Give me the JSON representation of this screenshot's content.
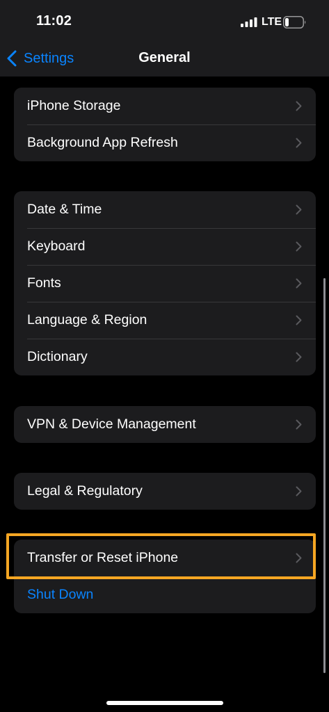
{
  "status_bar": {
    "time": "11:02",
    "network": "LTE"
  },
  "nav": {
    "back_label": "Settings",
    "title": "General"
  },
  "groups": [
    {
      "items": [
        {
          "label": "iPhone Storage"
        },
        {
          "label": "Background App Refresh"
        }
      ]
    },
    {
      "items": [
        {
          "label": "Date & Time"
        },
        {
          "label": "Keyboard"
        },
        {
          "label": "Fonts"
        },
        {
          "label": "Language & Region"
        },
        {
          "label": "Dictionary"
        }
      ]
    },
    {
      "items": [
        {
          "label": "VPN & Device Management"
        }
      ]
    },
    {
      "items": [
        {
          "label": "Legal & Regulatory"
        }
      ]
    },
    {
      "items": [
        {
          "label": "Transfer or Reset iPhone"
        },
        {
          "label": "Shut Down"
        }
      ]
    }
  ],
  "colors": {
    "background": "#000000",
    "cell": "#1c1c1e",
    "accent_blue": "#0a84ff",
    "highlight": "#f5a623"
  },
  "icons": {
    "back": "chevron-left-icon",
    "row": "chevron-right-icon",
    "signal": "cellular-signal-icon",
    "battery": "battery-icon"
  }
}
